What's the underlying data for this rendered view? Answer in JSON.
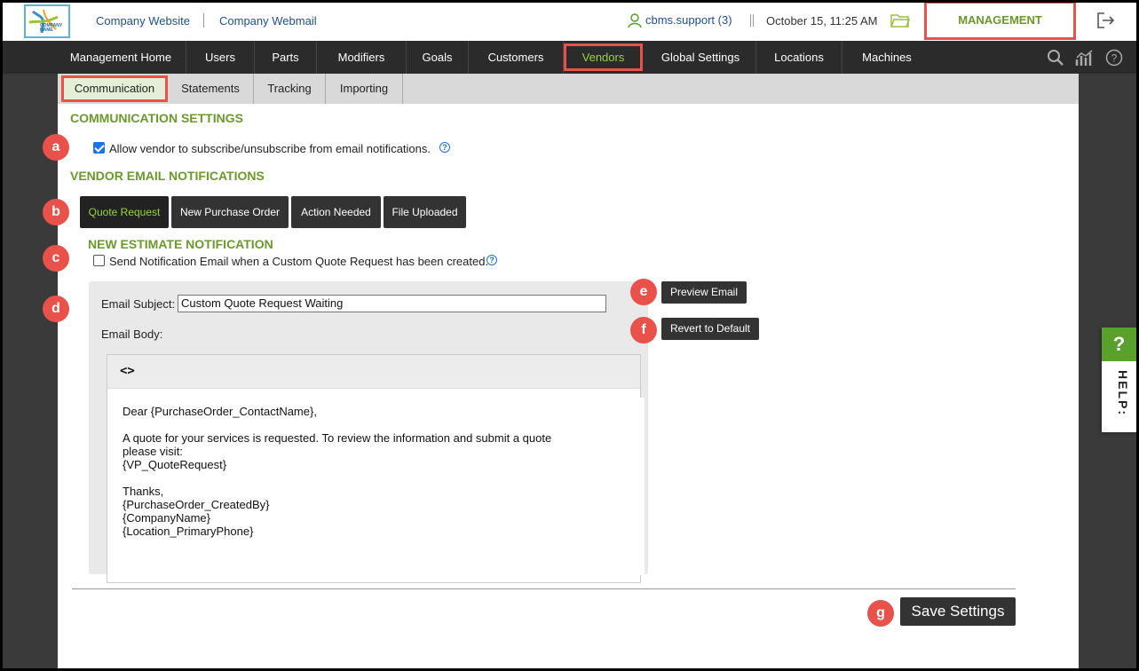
{
  "header": {
    "logo_text": "COMPANY NAME",
    "links": [
      "Company Website",
      "Company Webmail"
    ],
    "user": "cbms.support (3)",
    "separator": "||",
    "datetime": "October 15, 11:25 AM",
    "management_label": "MANAGEMENT"
  },
  "main_nav": {
    "items": [
      "Management Home",
      "Users",
      "Parts",
      "Modifiers",
      "Goals",
      "Customers",
      "Vendors",
      "Global Settings",
      "Locations",
      "Machines"
    ],
    "active": "Vendors"
  },
  "sub_nav": {
    "tabs": [
      "Communication",
      "Statements",
      "Tracking",
      "Importing"
    ],
    "active": "Communication"
  },
  "communication": {
    "title": "COMMUNICATION SETTINGS",
    "allow_label": "Allow vendor to subscribe/unsubscribe from email notifications.",
    "allow_checked": true
  },
  "vendor_notifications": {
    "title": "VENDOR EMAIL NOTIFICATIONS",
    "buttons": [
      "Quote Request",
      "New Purchase Order",
      "Action Needed",
      "File Uploaded"
    ],
    "active": "Quote Request"
  },
  "estimate": {
    "title": "NEW ESTIMATE NOTIFICATION",
    "send_label": "Send Notification Email when a Custom Quote Request has been created.",
    "send_checked": false,
    "subject_label": "Email Subject:",
    "subject_value": "Custom Quote Request Waiting",
    "body_label": "Email Body:",
    "body_lines": [
      "Dear {PurchaseOrder_ContactName},",
      "",
      "A quote for your services is requested. To review the information and submit a quote",
      "please visit:",
      "{VP_QuoteRequest}",
      "",
      "Thanks,",
      "{PurchaseOrder_CreatedBy}",
      "{CompanyName}",
      "{Location_PrimaryPhone}"
    ],
    "code_toggle": "<>",
    "preview_label": "Preview Email",
    "revert_label": "Revert to Default"
  },
  "save_label": "Save Settings",
  "help_tab": {
    "symbol": "?",
    "label": "HELP:"
  },
  "markers": [
    "a",
    "b",
    "c",
    "d",
    "e",
    "f",
    "g"
  ],
  "colors": {
    "accent_green": "#6a9a2a",
    "highlight_red": "#e8524a",
    "nav_dark": "#2b2b2b"
  }
}
